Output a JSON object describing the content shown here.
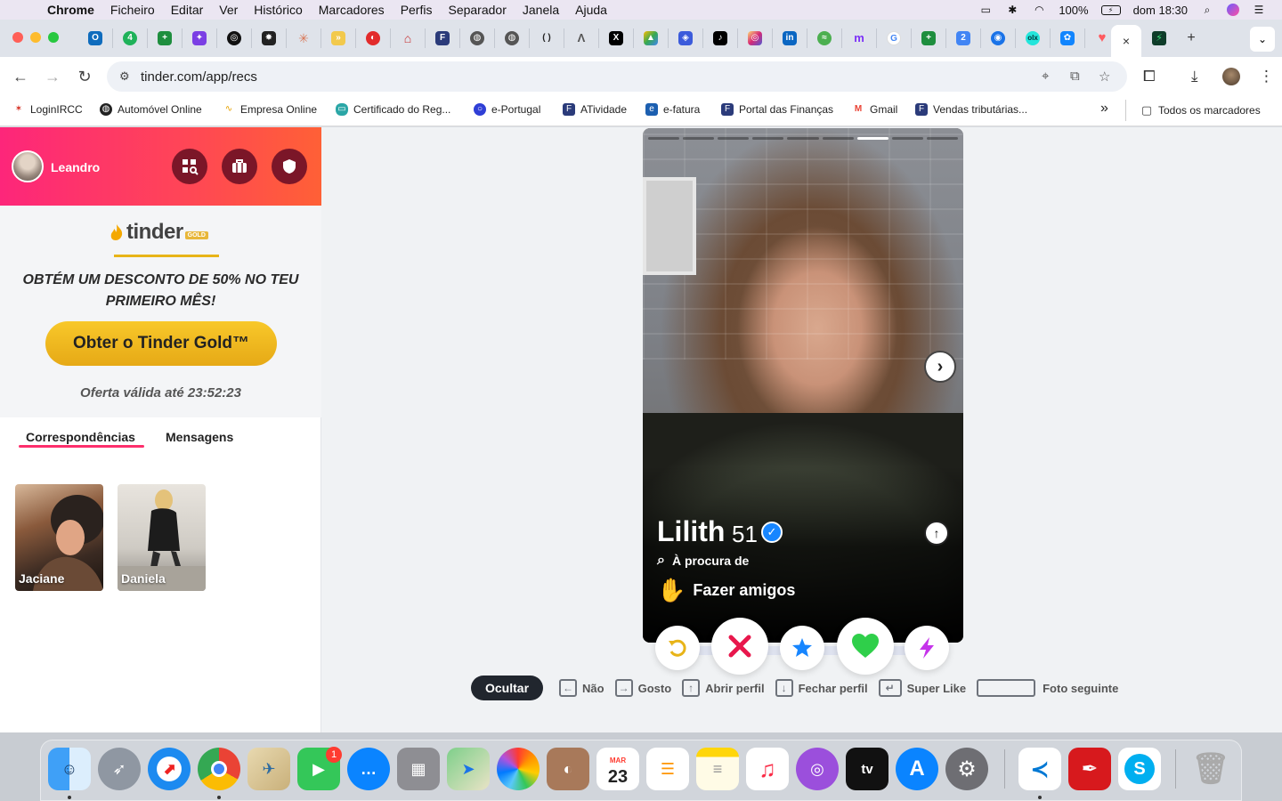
{
  "menubar": {
    "app": "Chrome",
    "items": [
      "Ficheiro",
      "Editar",
      "Ver",
      "Histórico",
      "Marcadores",
      "Perfis",
      "Separador",
      "Janela",
      "Ajuda"
    ],
    "battery": "100%",
    "clock": "dom 18:30"
  },
  "browser": {
    "url": "tinder.com/app/recs",
    "tab_close": "×",
    "new_tab": "+",
    "bookmarks": [
      "LoginIRCC",
      "Automóvel Online",
      "Empresa Online",
      "Certificado do Reg...",
      "e-Portugal",
      "ATividade",
      "e-fatura",
      "Portal das Finanças",
      "Gmail",
      "Vendas tributárias..."
    ],
    "more": "»",
    "all_bookmarks": "Todos os marcadores"
  },
  "sidebar": {
    "user_name": "Leandro",
    "logo_text": "tinder",
    "logo_badge": "GOLD",
    "promo_text": "OBTÉM UM DESCONTO DE 50% NO TEU PRIMEIRO MÊS!",
    "cta_label": "Obter o Tinder Gold™",
    "offer_text": "Oferta válida até 23:52:23",
    "tabs": [
      "Correspondências",
      "Mensagens"
    ],
    "matches": [
      "Jaciane",
      "Daniela"
    ]
  },
  "profile": {
    "name": "Lilith",
    "age": "51",
    "looking_for_label": "À procura de",
    "intent": "Fazer amigos",
    "photo_count": 9,
    "photo_index": 6
  },
  "shortcuts": {
    "hide_label": "Ocultar",
    "items": [
      {
        "key": "←",
        "label": "Não"
      },
      {
        "key": "→",
        "label": "Gosto"
      },
      {
        "key": "↑",
        "label": "Abrir perfil"
      },
      {
        "key": "↓",
        "label": "Fechar perfil"
      },
      {
        "key": "↵",
        "label": "Super Like"
      },
      {
        "key": "",
        "label": "Foto seguinte"
      }
    ]
  },
  "dock": {
    "calendar_month": "MAR",
    "calendar_day": "23",
    "tv_label": "tv",
    "facetime_badge": "1"
  },
  "colors": {
    "brand_gradient_start": "#fd267a",
    "brand_gradient_end": "#ff6036",
    "gold": "#f8c82a",
    "nope": "#e8174c",
    "super": "#1786ff",
    "like": "#2fcf4a",
    "boost": "#c533ea",
    "rewind": "#e8b418"
  }
}
